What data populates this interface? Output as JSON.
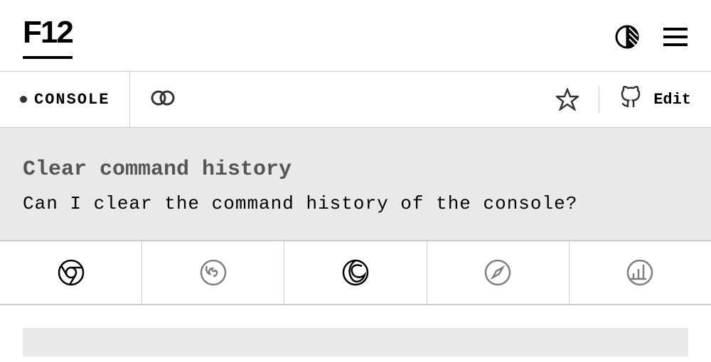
{
  "header": {
    "logo": "F12"
  },
  "toolbar": {
    "console_label": "CONSOLE",
    "edit_label": "Edit"
  },
  "content": {
    "title": "Clear command history",
    "subtitle": "Can I clear the command history of the console?"
  },
  "browsers": [
    {
      "name": "chrome",
      "active": true
    },
    {
      "name": "firefox",
      "active": false
    },
    {
      "name": "edge",
      "active": true
    },
    {
      "name": "safari",
      "active": false
    },
    {
      "name": "polypane",
      "active": false
    }
  ]
}
